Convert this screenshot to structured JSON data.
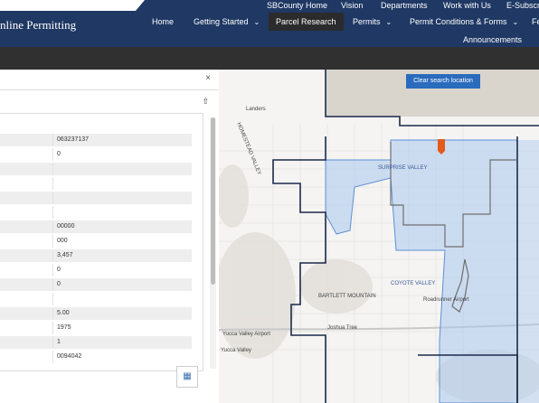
{
  "utility_links": [
    "SBCounty Home",
    "Vision",
    "Departments",
    "Work with Us",
    "E-Subscri"
  ],
  "brand": "nline Permitting",
  "nav": {
    "items": [
      "Home",
      "Getting Started",
      "Parcel Research",
      "Permits",
      "Permit Conditions & Forms",
      "Fe"
    ],
    "active": "Parcel Research",
    "second_row": "Announcements"
  },
  "panel": {
    "close_icon": "×",
    "share_icon": "⇧",
    "rows": [
      {
        "label": "",
        "value": "063237137"
      },
      {
        "label": "",
        "value": "0"
      },
      {
        "label": "",
        "value": ""
      },
      {
        "label": "",
        "value": ""
      },
      {
        "label": "",
        "value": ""
      },
      {
        "label": "",
        "value": ""
      },
      {
        "label": "",
        "value": "00000"
      },
      {
        "label": "",
        "value": "000"
      },
      {
        "label": "",
        "value": "3,457"
      },
      {
        "label": "",
        "value": "0"
      },
      {
        "label": "",
        "value": "0"
      },
      {
        "label": "",
        "value": ""
      },
      {
        "label": "",
        "value": "5.00"
      },
      {
        "label": "",
        "value": "1975"
      },
      {
        "label": "",
        "value": "1"
      },
      {
        "label": "",
        "value": "0094042"
      }
    ]
  },
  "map": {
    "clear_button": "Clear search location",
    "labels": {
      "landers": "Landers",
      "homestead_valley": "HOMESTEAD VALLEY",
      "surprise_valley": "SURPRISE VALLEY",
      "coyote_valley": "COYOTE VALLEY",
      "bartlett_mountain": "BARTLETT MOUNTAIN",
      "joshua_tree": "Joshua Tree",
      "yucca_valley": "Yucca Valley",
      "yucca_valley_airport": "Yucca Valley Airport",
      "twentynine_palms_airport": "Roadrunner Airport"
    }
  }
}
